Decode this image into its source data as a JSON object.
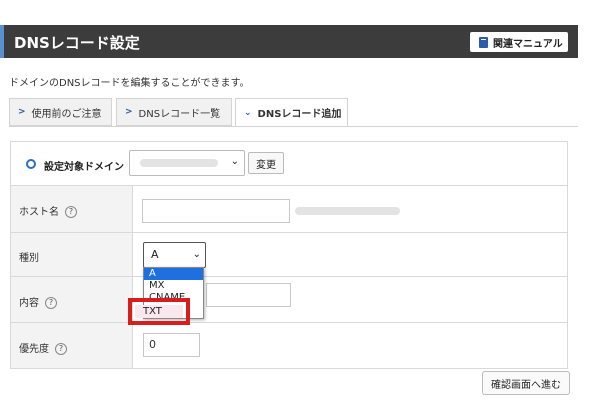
{
  "header": {
    "title": "DNSレコード設定",
    "manual_button": "関連マニュアル"
  },
  "description": "ドメインのDNSレコードを編集することができます。",
  "tabs": [
    {
      "label": "使用前のご注意",
      "active": false
    },
    {
      "label": "DNSレコード一覧",
      "active": false
    },
    {
      "label": "DNSレコード追加",
      "active": true
    }
  ],
  "form": {
    "domain": {
      "label": "設定対象ドメイン",
      "change_button": "変更"
    },
    "host": {
      "label": "ホスト名",
      "help": "?"
    },
    "type": {
      "label": "種別",
      "value": "A",
      "options": [
        "A",
        "MX",
        "CNAME",
        "TXT"
      ],
      "highlighted_option": "TXT"
    },
    "content": {
      "label": "内容",
      "help": "?"
    },
    "priority": {
      "label": "優先度",
      "help": "?",
      "value": "0"
    }
  },
  "confirm_button": "確認画面へ進む",
  "colors": {
    "header_bg": "#3c3c3c",
    "accent": "#2a5ca8",
    "highlight_border": "#d81d1d",
    "selected_option": "#1e6fe0"
  }
}
